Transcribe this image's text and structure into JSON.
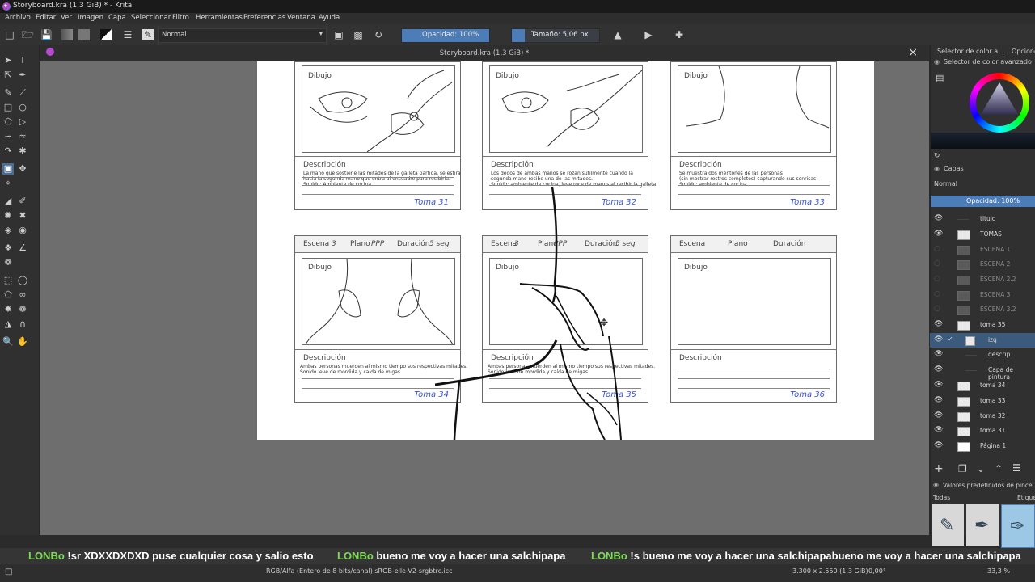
{
  "window": {
    "title": "Storyboard.kra (1,3 GiB) * - Krita"
  },
  "menu": [
    "Archivo",
    "Editar",
    "Ver",
    "Imagen",
    "Capa",
    "Seleccionar",
    "Filtro",
    "Herramientas",
    "Preferencias",
    "Ventana",
    "Ayuda"
  ],
  "toolbar": {
    "blend_mode": "Normal",
    "opacity_label": "Opacidad: 100%",
    "opacity_value": 1.0,
    "size_label": "Tamaño: 5,06 px"
  },
  "document": {
    "tab_title": "Storyboard.kra (1,3 GiB) *"
  },
  "storyboard": {
    "panels": [
      {
        "draw_label": "Dibujo",
        "desc_label": "Descripción",
        "desc": "La mano que sostiene las mitades de la galleta partida, se estira\nhacia la segunda mano que entra al encuadre para recibirla.\nSonido: Ambiente de cocina",
        "toma": "Toma 31"
      },
      {
        "draw_label": "Dibujo",
        "desc_label": "Descripción",
        "desc": "Los dedos de ambas manos se rozan sutilmente cuando la\nsegunda mano recibe una de las mitades.\nSonido: ambiente de cocina, leve roce de manos al recibir la galleta",
        "toma": "Toma 32"
      },
      {
        "draw_label": "Dibujo",
        "desc_label": "Descripción",
        "desc": "Se muestra dos mentones de las personas\n(sin mostrar rostros completos) capturando sus sonrisas\nSonido: ambiente de cocina",
        "toma": "Toma 33"
      },
      {
        "escena": "Escena",
        "escena_val": "3",
        "plano": "Plano",
        "plano_val": "PPP",
        "duracion": "Duración",
        "duracion_val": "5 seg",
        "draw_label": "Dibujo",
        "desc_label": "Descripción",
        "desc": "Ambas personas muerden al mismo tiempo sus respectivas mitades.\nSonido leve de mordida y caída de migas",
        "toma": "Toma 34"
      },
      {
        "escena": "Escena",
        "escena_val": "3",
        "plano": "Plano",
        "plano_val": "PPP",
        "duracion": "Duración",
        "duracion_val": "5 seg",
        "draw_label": "Dibujo",
        "desc_label": "Descripción",
        "desc": "Ambas personas muerden al mismo tiempo sus respectivas mitades.\nSonido leve de mordida y caída de migas",
        "toma": "Toma 35"
      },
      {
        "escena": "Escena",
        "plano": "Plano",
        "duracion": "Duración",
        "draw_label": "Dibujo",
        "desc_label": "Descripción",
        "desc": "",
        "toma": "Toma 36"
      }
    ]
  },
  "dock": {
    "tab_color": "Selector de color a...",
    "tab_options": "Opcione",
    "color_selector_title": "Selector de color avanzado",
    "layers_title": "Capas",
    "layers_blend": "Normal",
    "layers_opacity": "Opacidad:  100%",
    "layers": [
      {
        "name": "titulo",
        "visible": true,
        "dim": false,
        "selected": false
      },
      {
        "name": "TOMAS",
        "visible": true,
        "dim": false,
        "selected": false
      },
      {
        "name": "ESCENA 1",
        "visible": false,
        "dim": true,
        "selected": false
      },
      {
        "name": "ESCENA 2",
        "visible": false,
        "dim": true,
        "selected": false
      },
      {
        "name": "ESCENA 2.2",
        "visible": false,
        "dim": true,
        "selected": false
      },
      {
        "name": "ESCENA 3",
        "visible": false,
        "dim": true,
        "selected": false
      },
      {
        "name": "ESCENA 3.2",
        "visible": false,
        "dim": true,
        "selected": false
      },
      {
        "name": "toma 35",
        "visible": true,
        "dim": false,
        "selected": false
      },
      {
        "name": "izq",
        "visible": true,
        "dim": false,
        "selected": true
      },
      {
        "name": "descrip",
        "visible": true,
        "dim": false,
        "selected": false
      },
      {
        "name": "Capa de pintura",
        "visible": true,
        "dim": false,
        "selected": false
      },
      {
        "name": "toma 34",
        "visible": true,
        "dim": false,
        "selected": false
      },
      {
        "name": "toma 33",
        "visible": true,
        "dim": false,
        "selected": false
      },
      {
        "name": "toma 32",
        "visible": true,
        "dim": false,
        "selected": false
      },
      {
        "name": "toma 31",
        "visible": true,
        "dim": false,
        "selected": false
      },
      {
        "name": "Página 1",
        "visible": true,
        "dim": false,
        "selected": false
      }
    ],
    "presets_title": "Valores predefinidos de pincel",
    "presets_filter": "Todas",
    "presets_tag": "Etique"
  },
  "chat": [
    {
      "user": "LONBo",
      "text": " !sr XDXXDXDXD puse cualquier cosa y salio esto"
    },
    {
      "user": "LONBo",
      "text": " bueno me voy a hacer una salchipapa"
    },
    {
      "user": "LONBo",
      "text": " !s bueno me voy a hacer una salchipapabueno me voy a hacer una salchipapa"
    }
  ],
  "status": {
    "color_info": "RGB/Alfa (Entero de 8 bits/canal)  sRGB-elle-V2-srgbtrc.icc",
    "dimensions": "3.300 x 2.550 (1,3 GiB)",
    "rotation": "0,00°",
    "zoom": "33,3 %"
  },
  "colors": {
    "accent": "#4d7db8",
    "chat_user": "#7ed957",
    "handwriting": "#3a55c8"
  }
}
